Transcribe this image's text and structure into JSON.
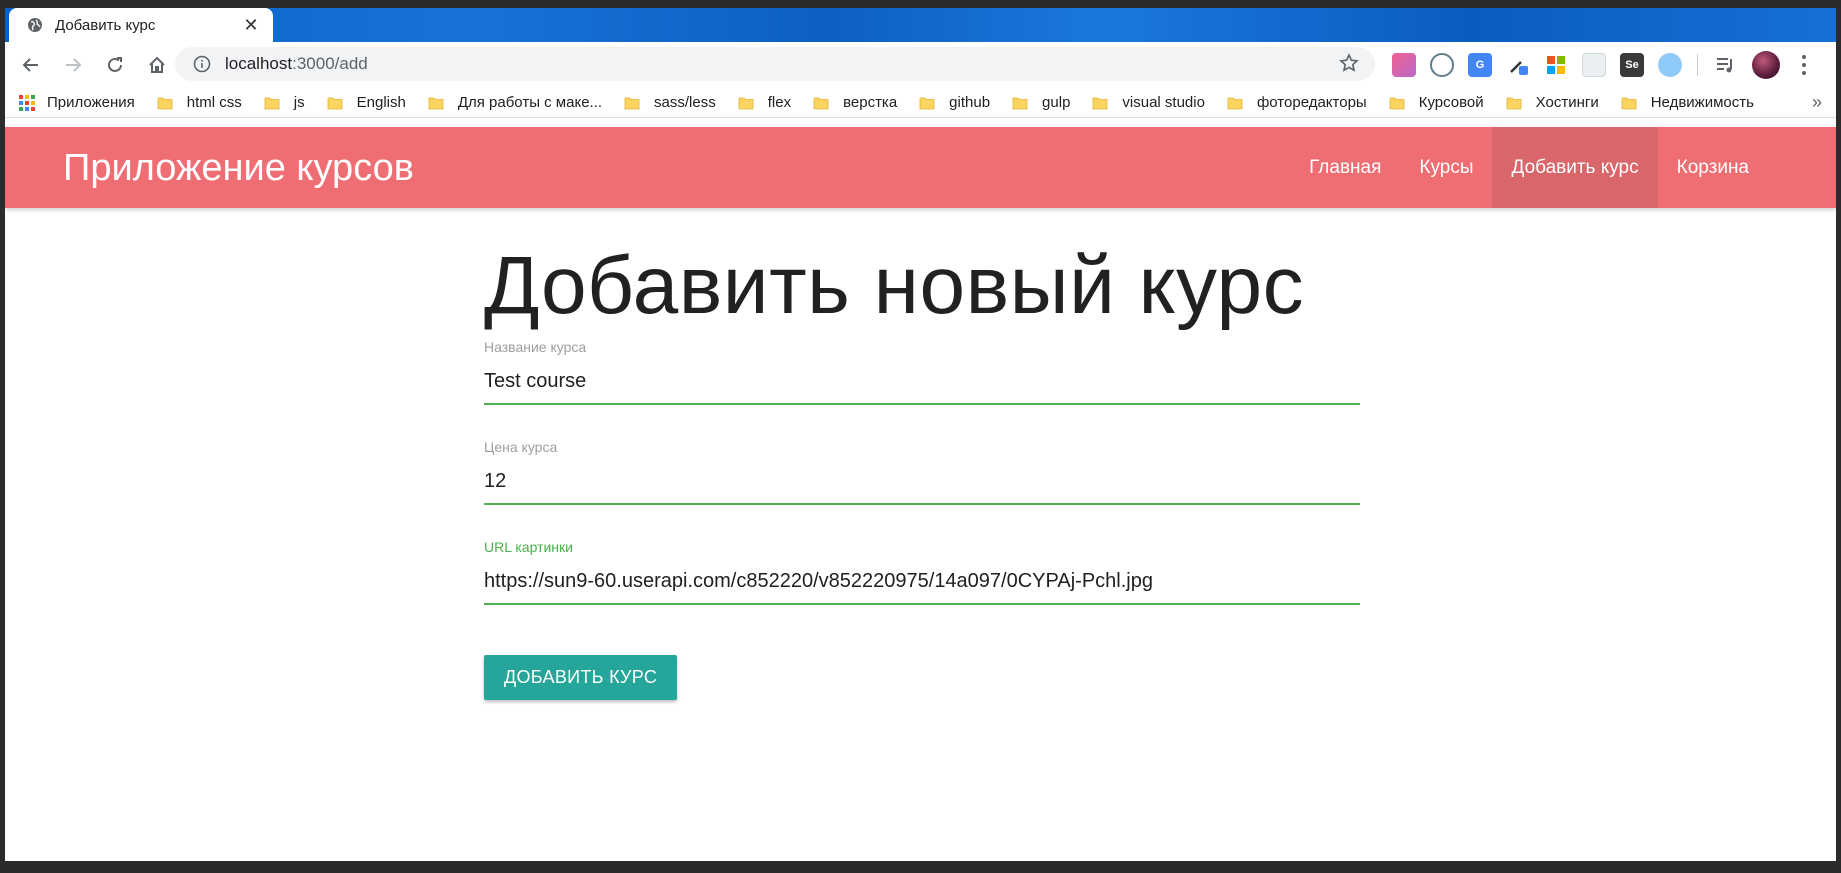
{
  "browser": {
    "tab_title": "Добавить курс",
    "url_host": "localhost",
    "url_path": ":3000/add",
    "bookmarks": [
      {
        "label": "Приложения",
        "icon": "apps-icon"
      },
      {
        "label": "html css",
        "icon": "folder-icon"
      },
      {
        "label": "js",
        "icon": "folder-icon"
      },
      {
        "label": "English",
        "icon": "folder-icon"
      },
      {
        "label": "Для работы с маке...",
        "icon": "folder-icon"
      },
      {
        "label": "sass/less",
        "icon": "folder-icon"
      },
      {
        "label": "flex",
        "icon": "folder-icon"
      },
      {
        "label": "верстка",
        "icon": "folder-icon"
      },
      {
        "label": "github",
        "icon": "folder-icon"
      },
      {
        "label": "gulp",
        "icon": "folder-icon"
      },
      {
        "label": "visual studio",
        "icon": "folder-icon"
      },
      {
        "label": "фоторедакторы",
        "icon": "folder-icon"
      },
      {
        "label": "Курсовой",
        "icon": "folder-icon"
      },
      {
        "label": "Хостинги",
        "icon": "folder-icon"
      },
      {
        "label": "Недвижимость",
        "icon": "folder-icon"
      }
    ],
    "more_bookmarks": "»"
  },
  "app": {
    "brand": "Приложение курсов",
    "nav": [
      {
        "label": "Главная",
        "active": false
      },
      {
        "label": "Курсы",
        "active": false
      },
      {
        "label": "Добавить курс",
        "active": true
      },
      {
        "label": "Корзина",
        "active": false
      }
    ],
    "accent_color": "#ef6e73",
    "active_nav_color": "#d9666a",
    "button_color": "#26a69a",
    "field_line_color": "#4caf50"
  },
  "form": {
    "title": "Добавить новый курс",
    "title_field": {
      "label": "Название курса",
      "value": "Test course"
    },
    "price_field": {
      "label": "Цена курса",
      "value": "12"
    },
    "img_field": {
      "label": "URL картинки",
      "value": "https://sun9-60.userapi.com/c852220/v852220975/14a097/0CYPAj-Pchl.jpg"
    },
    "submit_label": "ДОБАВИТЬ КУРС"
  }
}
